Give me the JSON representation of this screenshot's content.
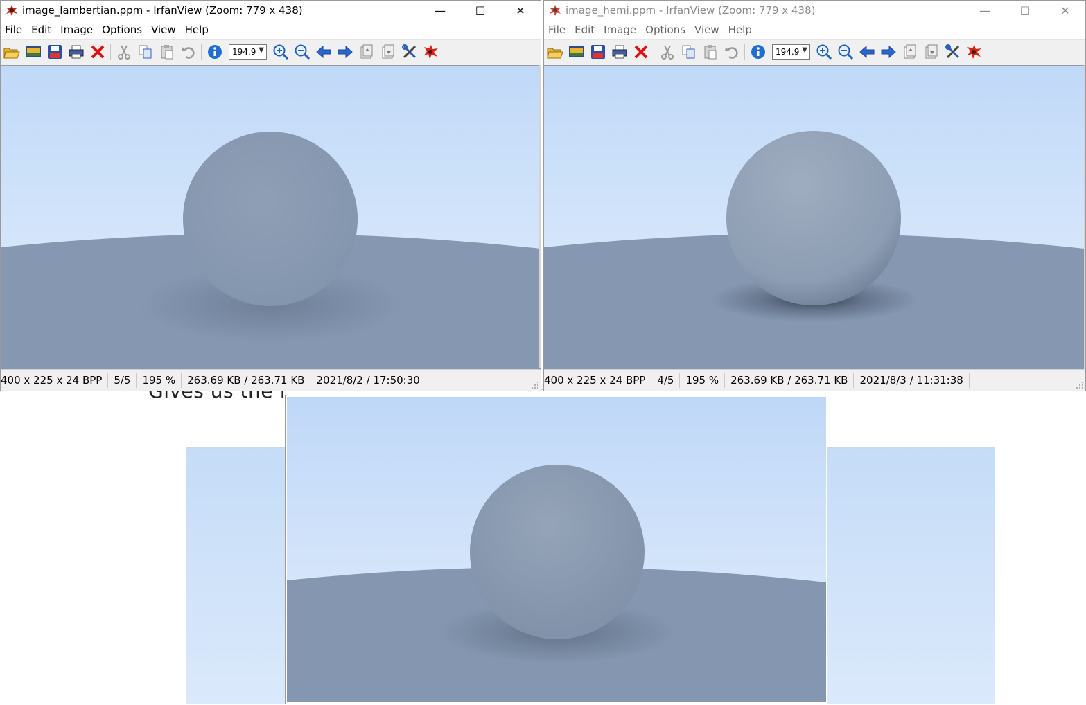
{
  "background_doc": {
    "text": "Gives us the f"
  },
  "window_left": {
    "title": "image_lambertian.ppm - IrfanView (Zoom: 779 x 438)",
    "active": true,
    "menu": [
      "File",
      "Edit",
      "Image",
      "Options",
      "View",
      "Help"
    ],
    "zoom_value": "194.9",
    "status": {
      "dimensions": "400 x 225 x 24 BPP",
      "index": "5/5",
      "zoom_percent": "195 %",
      "file_size": "263.69 KB / 263.71 KB",
      "datetime": "2021/8/2 / 17:50:30"
    }
  },
  "window_right": {
    "title": "image_hemi.ppm - IrfanView (Zoom: 779 x 438)",
    "active": false,
    "menu": [
      "File",
      "Edit",
      "Image",
      "Options",
      "View",
      "Help"
    ],
    "zoom_value": "194.9",
    "status": {
      "dimensions": "400 x 225 x 24 BPP",
      "index": "4/5",
      "zoom_percent": "195 %",
      "file_size": "263.69 KB / 263.71 KB",
      "datetime": "2021/8/3 / 11:31:38"
    }
  },
  "window_controls": {
    "minimize": "—",
    "maximize": "☐",
    "close": "✕"
  },
  "toolbar_icons": [
    "open-folder-icon",
    "thumbnails-icon",
    "save-icon",
    "print-icon",
    "delete-icon",
    "cut-icon",
    "copy-icon",
    "paste-icon",
    "undo-icon",
    "info-icon",
    "zoom-in-icon",
    "zoom-out-icon",
    "previous-icon",
    "next-icon",
    "first-page-icon",
    "last-page-icon",
    "settings-icon",
    "irfanview-logo-icon"
  ],
  "colors": {
    "sky_top": "#c0d9f8",
    "sky_bottom": "#e3eefb",
    "ground": "#8597b1",
    "sphere": "#8b9cb4"
  }
}
